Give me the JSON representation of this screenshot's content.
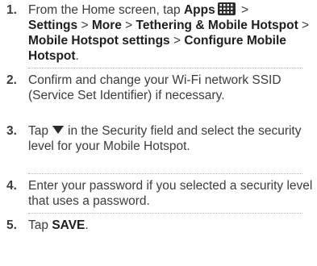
{
  "icons": {
    "apps": "apps-grid-icon",
    "dropdown": "dropdown-triangle-icon"
  },
  "colors": {
    "text": "#3c3c3c",
    "bold_text": "#1e1e1e",
    "divider": "#b8b8b8",
    "apps_icon_bg": "#2b2b2b"
  },
  "steps": [
    {
      "number": "1.",
      "parts": {
        "a": "From the Home screen, tap ",
        "b": "Apps",
        "c": " > ",
        "d": "Settings",
        "e": " > ",
        "f": "More",
        "g": " > ",
        "h": "Tethering & Mobile Hotspot",
        "i": " > ",
        "j": "Mobile Hotspot settings",
        "k": " > ",
        "l": "Configure Mobile Hotspot",
        "m": "."
      }
    },
    {
      "number": "2.",
      "text": "Confirm and change your Wi-Fi network SSID (Service Set Identifier) if necessary."
    },
    {
      "number": "3.",
      "parts": {
        "a": "Tap",
        "b": "in the Security field and select the security level for your Mobile Hotspot."
      }
    },
    {
      "number": "4.",
      "text": "Enter your password if you selected a security level that uses a password."
    },
    {
      "number": "5.",
      "parts": {
        "a": "Tap ",
        "b": "SAVE",
        "c": "."
      }
    }
  ]
}
